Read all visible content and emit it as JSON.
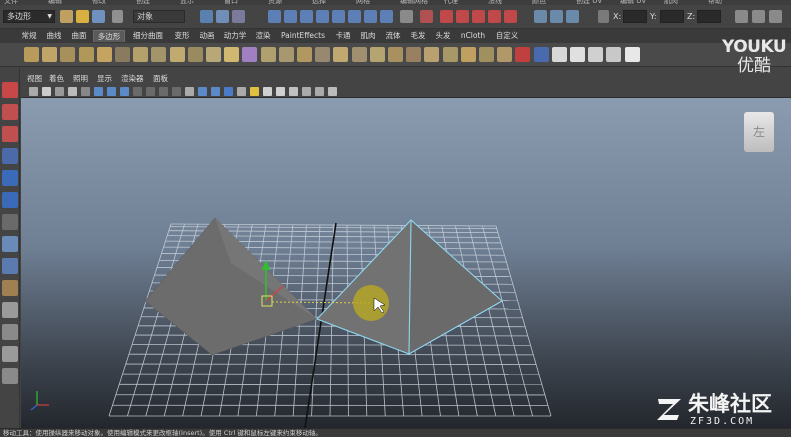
{
  "menu": {
    "items": [
      "文件",
      "编辑",
      "修改",
      "创建",
      "显示",
      "窗口",
      "资源",
      "选择",
      "网格",
      "编辑网格",
      "代理",
      "法线",
      "颜色",
      "创建 UV",
      "编辑 UV",
      "肌肉",
      "帮助"
    ]
  },
  "status_line": {
    "mode": "多边形",
    "selection_field": "对象",
    "coord_labels": [
      "X:",
      "Y:",
      "Z:"
    ]
  },
  "shelf": {
    "tabs": [
      "常规",
      "曲线",
      "曲面",
      "多边形",
      "细分曲面",
      "变形",
      "动画",
      "动力学",
      "渲染",
      "PaintEffects",
      "卡通",
      "肌肉",
      "流体",
      "毛发",
      "头发",
      "nCloth",
      "自定义"
    ],
    "active_tab": "多边形"
  },
  "panel": {
    "menu": [
      "视图",
      "着色",
      "照明",
      "显示",
      "渲染器",
      "面板"
    ]
  },
  "viewcube": {
    "face": "左"
  },
  "watermark": {
    "brand": "YOUKU",
    "brand_cn": "优酷",
    "community": "朱峰社区",
    "domain": "ZF3D.COM"
  },
  "help_line": "移动工具：使用操纵器来移动对象。使用编辑模式来更改枢轴(Insert)。使用 Ctrl 键和鼠标左键来约束移动轴。",
  "colors": {
    "viewport_top": "#8b9bb0",
    "viewport_bottom": "#23272d",
    "mesh_fill": "#6e6e6e",
    "selection_edge": "#8fd6f0",
    "grid_line": "#c8d0da",
    "highlight_ring": "#b8a820"
  }
}
